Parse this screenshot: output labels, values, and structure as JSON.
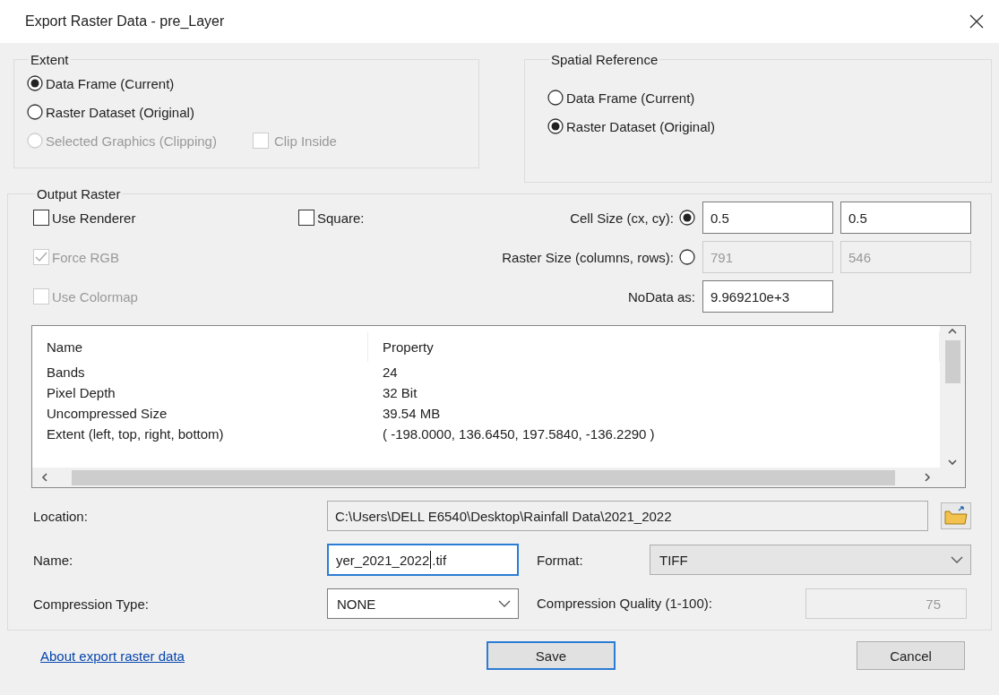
{
  "window": {
    "title": "Export Raster Data - pre_Layer"
  },
  "extent": {
    "label": "Extent",
    "options": [
      {
        "label": "Data Frame (Current)",
        "selected": true,
        "disabled": false
      },
      {
        "label": "Raster Dataset (Original)",
        "selected": false,
        "disabled": false
      },
      {
        "label": "Selected Graphics (Clipping)",
        "selected": false,
        "disabled": true
      }
    ],
    "clip_inside": {
      "label": "Clip Inside",
      "checked": false,
      "disabled": true
    }
  },
  "spatial_reference": {
    "label": "Spatial Reference",
    "options": [
      {
        "label": "Data Frame (Current)",
        "selected": false,
        "disabled": false
      },
      {
        "label": "Raster Dataset (Original)",
        "selected": true,
        "disabled": false
      }
    ]
  },
  "output_raster": {
    "label": "Output Raster",
    "checkboxes": [
      {
        "label": "Use Renderer",
        "checked": false,
        "disabled": false
      },
      {
        "label": "Force RGB",
        "checked": true,
        "disabled": true
      },
      {
        "label": "Use Colormap",
        "checked": false,
        "disabled": true
      }
    ],
    "square": {
      "label": "Square:",
      "checked": false,
      "disabled": false
    },
    "size_modes": [
      {
        "label": "Cell Size (cx, cy):",
        "selected": true,
        "disabled": false,
        "values": [
          "0.5",
          "0.5"
        ]
      },
      {
        "label": "Raster Size (columns, rows):",
        "selected": false,
        "disabled": true,
        "values": [
          "791",
          "546"
        ]
      }
    ],
    "nodata": {
      "label": "NoData as:",
      "value": "9.969210e+3"
    },
    "table": {
      "columns": [
        "Name",
        "Property"
      ],
      "rows": [
        [
          "Bands",
          "24"
        ],
        [
          "Pixel Depth",
          "32 Bit"
        ],
        [
          "Uncompressed Size",
          "39.54 MB"
        ],
        [
          "Extent (left, top, right, bottom)",
          "( -198.0000, 136.6450, 197.5840, -136.2290 )"
        ]
      ]
    },
    "location": {
      "label": "Location:",
      "value": "C:\\Users\\DELL E6540\\Desktop\\Rainfall Data\\2021_2022"
    },
    "name": {
      "label": "Name:",
      "value": "yer_2021_2022.tif",
      "focused": true
    },
    "format": {
      "label": "Format:",
      "value": "TIFF"
    },
    "compression_type": {
      "label": "Compression Type:",
      "value": "NONE"
    },
    "compression_quality": {
      "label": "Compression Quality (1-100):",
      "value": "75",
      "disabled": true
    }
  },
  "link": "About export raster data",
  "buttons": [
    {
      "label": "Save",
      "default": true
    },
    {
      "label": "Cancel",
      "default": false
    }
  ]
}
